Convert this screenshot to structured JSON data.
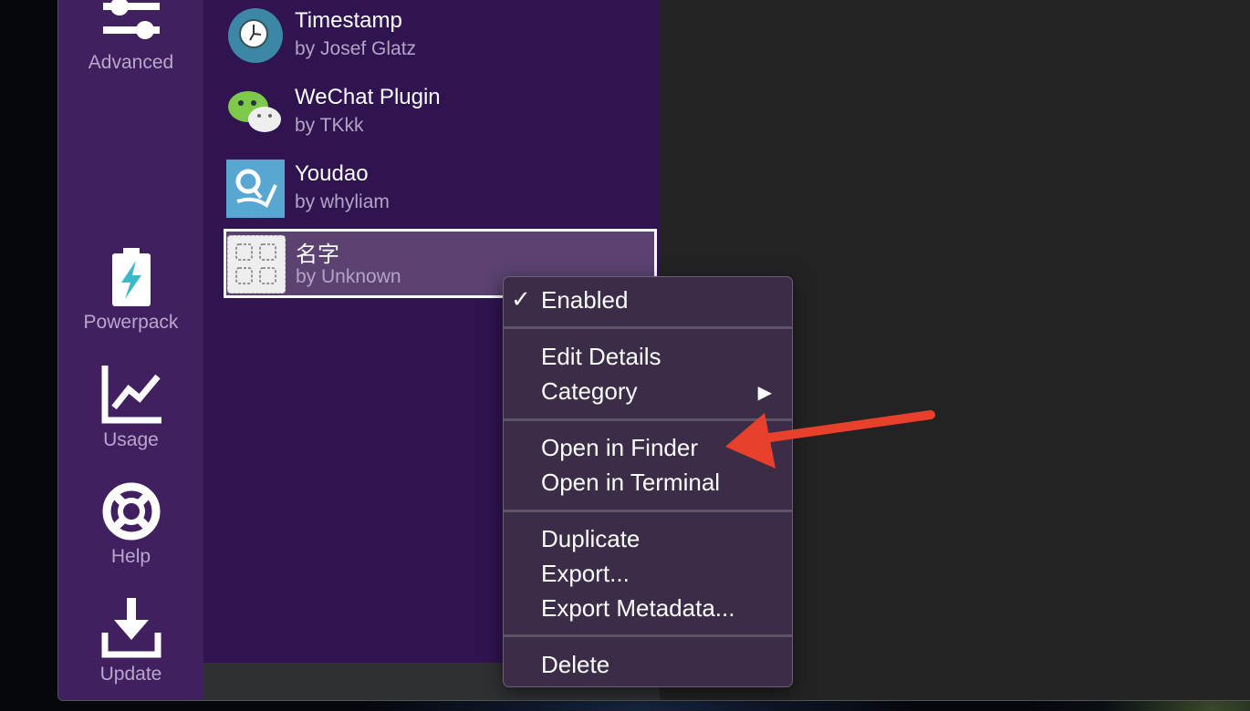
{
  "sidebar": {
    "items": [
      {
        "label": "Advanced",
        "icon": "sliders-icon"
      },
      {
        "label": "Powerpack",
        "icon": "battery-bolt-icon"
      },
      {
        "label": "Usage",
        "icon": "chart-line-icon"
      },
      {
        "label": "Help",
        "icon": "lifebuoy-icon"
      },
      {
        "label": "Update",
        "icon": "download-icon"
      }
    ]
  },
  "workflows": [
    {
      "title": "Timestamp",
      "author": "by Josef Glatz",
      "icon": "clock-icon"
    },
    {
      "title": "WeChat Plugin",
      "author": "by TKkk",
      "icon": "wechat-icon"
    },
    {
      "title": "Youdao",
      "author": "by whyliam",
      "icon": "youdao-icon"
    },
    {
      "title": "名字",
      "author": "by Unknown",
      "icon": "placeholder-grid-icon",
      "selected": true
    }
  ],
  "context_menu": {
    "check": "✓",
    "submenu_arrow": "▶",
    "items": [
      "Enabled",
      "Edit Details",
      "Category",
      "Open in Finder",
      "Open in Terminal",
      "Duplicate",
      "Export...",
      "Export Metadata...",
      "Delete"
    ],
    "enabled_checked": true
  },
  "colors": {
    "sidebar": "#40205f",
    "list": "#2f1450",
    "selection": "#5b4271",
    "annotation_arrow": "#e8402a"
  }
}
